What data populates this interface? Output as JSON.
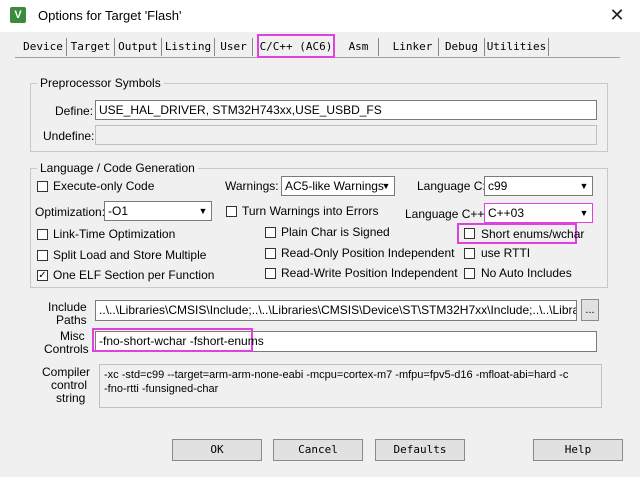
{
  "window": {
    "title": "Options for Target 'Flash'",
    "icon_glyph": "V",
    "close_glyph": "✕"
  },
  "tabs": [
    "Device",
    "Target",
    "Output",
    "Listing",
    "User",
    "C/C++ (AC6)",
    "Asm",
    "Linker",
    "Debug",
    "Utilities"
  ],
  "preprocessor": {
    "group_title": "Preprocessor Symbols",
    "define_label": "Define:",
    "define_value": "USE_HAL_DRIVER, STM32H743xx,USE_USBD_FS",
    "undefine_label": "Undefine:",
    "undefine_value": ""
  },
  "language": {
    "group_title": "Language / Code Generation",
    "execute_only": "Execute-only Code",
    "optimization_label": "Optimization:",
    "optimization_value": "-O1",
    "link_time": "Link-Time Optimization",
    "split_load": "Split Load and Store Multiple",
    "one_elf": "One ELF Section per Function",
    "warnings_label": "Warnings:",
    "warnings_value": "AC5-like Warnings",
    "turn_warnings": "Turn Warnings into Errors",
    "plain_char": "Plain Char is Signed",
    "ro_pos": "Read-Only Position Independent",
    "rw_pos": "Read-Write Position Independent",
    "lang_c_label": "Language C:",
    "lang_c_value": "c99",
    "lang_cpp_label": "Language C++:",
    "lang_cpp_value": "C++03",
    "short_enums": "Short enums/wchar",
    "use_rtti": "use RTTI",
    "no_auto": "No Auto Includes",
    "checkmark": "✓"
  },
  "paths": {
    "include_label_1": "Include",
    "include_label_2": "Paths",
    "include_value": "..\\..\\Libraries\\CMSIS\\Include;..\\..\\Libraries\\CMSIS\\Device\\ST\\STM32H7xx\\Include;..\\..\\Libraries\\S",
    "browse_label": "...",
    "misc_label_1": "Misc",
    "misc_label_2": "Controls",
    "misc_value": "-fno-short-wchar -fshort-enums",
    "compiler_label_1": "Compiler",
    "compiler_label_2": "control",
    "compiler_label_3": "string",
    "compiler_line_1": "-xc -std=c99 --target=arm-arm-none-eabi -mcpu=cortex-m7 -mfpu=fpv5-d16 -mfloat-abi=hard -c",
    "compiler_line_2": "-fno-rtti -funsigned-char"
  },
  "buttons": {
    "ok": "OK",
    "cancel": "Cancel",
    "defaults": "Defaults",
    "help": "Help"
  },
  "colors": {
    "highlight": "#e040e0"
  }
}
